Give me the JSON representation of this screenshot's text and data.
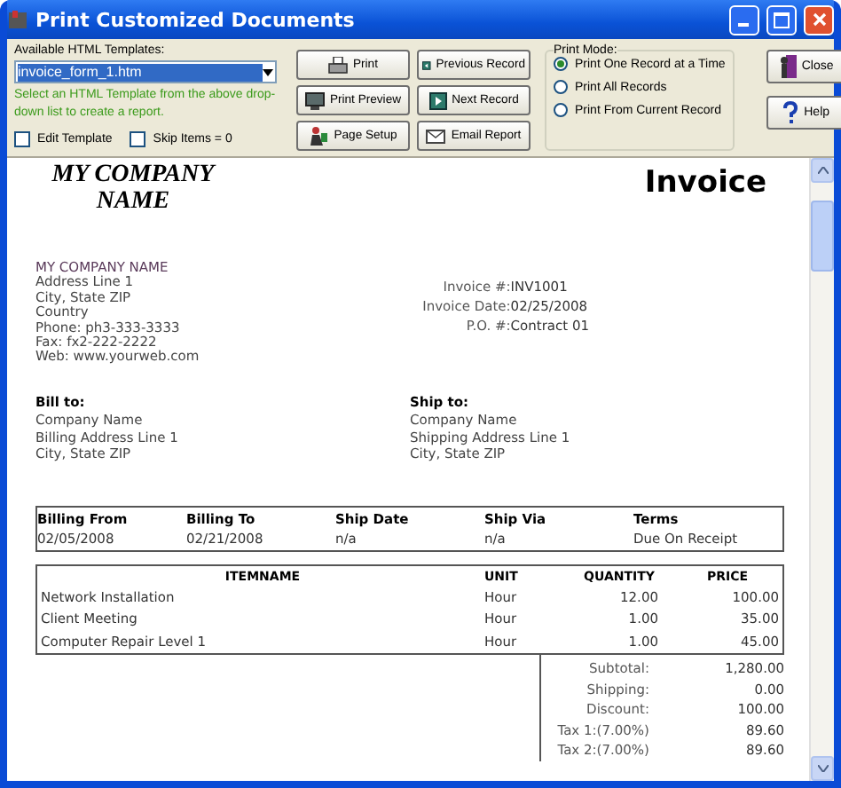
{
  "window": {
    "title": "Print Customized Documents"
  },
  "templates": {
    "label": "Available HTML Templates:",
    "value": "invoice_form_1.htm",
    "hint": "Select an HTML Template from the above drop-down list to create a report."
  },
  "options": [
    {
      "label": "Edit Template",
      "checked": false
    },
    {
      "label": "Skip Items = 0",
      "checked": false
    }
  ],
  "actions": [
    {
      "label": "Print",
      "kind": "printer"
    },
    {
      "label": "Previous Record",
      "kind": "previous"
    },
    {
      "label": "Print Preview",
      "kind": "monitor"
    },
    {
      "label": "Next Record",
      "kind": "next"
    },
    {
      "label": "Page Setup",
      "kind": "setup"
    },
    {
      "label": "Email Report",
      "kind": "envelope"
    }
  ],
  "print_mode": {
    "title": "Print Mode:",
    "options": [
      {
        "label": "Print One Record at a Time",
        "selected": true
      },
      {
        "label": "Print All Records",
        "selected": false
      },
      {
        "label": "Print From Current Record",
        "selected": false
      }
    ]
  },
  "side_buttons": [
    {
      "label": "Close",
      "kind": "door"
    },
    {
      "label": "Help",
      "kind": "help"
    }
  ],
  "invoice": {
    "company_name": "MY COMPANY NAME",
    "title": "Invoice",
    "sender": [
      "MY COMPANY NAME",
      "Address Line 1",
      "City, State ZIP",
      "Country",
      "Phone: ph3-333-3333",
      "Fax: fx2-222-2222",
      "Web: www.yourweb.com"
    ],
    "meta": [
      {
        "label": "Invoice #:",
        "value": "INV1001"
      },
      {
        "label": "Invoice Date:",
        "value": "02/25/2008"
      },
      {
        "label": "P.O. #:",
        "value": "Contract 01"
      }
    ],
    "bill_to": {
      "heading": "Bill to:",
      "lines": [
        "Company Name",
        "Billing Address Line 1",
        "City, State ZIP"
      ]
    },
    "ship_to": {
      "heading": "Ship to:",
      "lines": [
        "Company Name",
        "Shipping Address Line 1",
        "City, State ZIP"
      ]
    },
    "terms": {
      "columns": [
        "Billing From",
        "Billing To",
        "Ship Date",
        "Ship Via",
        "Terms"
      ],
      "row": [
        "02/05/2008",
        "02/21/2008",
        "n/a",
        "n/a",
        "Due On Receipt"
      ]
    },
    "items": {
      "columns": [
        "ITEMNAME",
        "UNIT",
        "QUANTITY",
        "PRICE"
      ],
      "rows": [
        [
          "Network Installation",
          "Hour",
          "12.00",
          "100.00"
        ],
        [
          "Client Meeting",
          "Hour",
          "1.00",
          "35.00"
        ],
        [
          "Computer Repair Level 1",
          "Hour",
          "1.00",
          "45.00"
        ]
      ]
    },
    "totals": [
      {
        "label": "Subtotal:",
        "value": "1,280.00"
      },
      {
        "label": "Shipping:",
        "value": "0.00"
      },
      {
        "label": "Discount:",
        "value": "100.00"
      },
      {
        "label": "Tax 1:(7.00%)",
        "value": "89.60"
      },
      {
        "label": "Tax 2:(7.00%)",
        "value": "89.60"
      }
    ]
  }
}
